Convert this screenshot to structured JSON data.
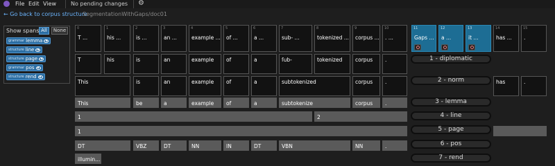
{
  "menubar": {
    "items": [
      "File",
      "Edit",
      "View"
    ],
    "status": "No pending changes"
  },
  "breadcrumb": {
    "back": "Go back to corpus structure",
    "path": "SegmentationWithGaps/doc01"
  },
  "left_panel": {
    "show_spans": "Show spans",
    "all": "All",
    "none": "None",
    "layers": [
      {
        "type": "grammar",
        "name": "lemma"
      },
      {
        "type": "structure",
        "name": "line"
      },
      {
        "type": "structure",
        "name": "page"
      },
      {
        "type": "grammar",
        "name": "pos"
      },
      {
        "type": "structure",
        "name": "rend"
      }
    ]
  },
  "tokens": [
    {
      "idx": "0",
      "text": "T ..."
    },
    {
      "idx": "1",
      "text": "his ..."
    },
    {
      "idx": "2",
      "text": "is ..."
    },
    {
      "idx": "3",
      "text": "an ..."
    },
    {
      "idx": "4",
      "text": "example ..."
    },
    {
      "idx": "5",
      "text": "of ..."
    },
    {
      "idx": "6",
      "text": "a ..."
    },
    {
      "idx": "7",
      "text": "sub- ..."
    },
    {
      "idx": "8",
      "text": "tokenized ..."
    },
    {
      "idx": "9",
      "text": "corpus ..."
    },
    {
      "idx": "10",
      "text": ". ..."
    },
    {
      "idx": "11",
      "text": "Gaps ..."
    },
    {
      "idx": "12",
      "text": "a ..."
    },
    {
      "idx": "13",
      "text": "it ..."
    },
    {
      "idx": "14",
      "text": "has ..."
    },
    {
      "idx": "15",
      "text": "."
    }
  ],
  "rows": {
    "diplomatic": [
      "T",
      "his",
      "is",
      "an",
      "example",
      "of",
      "a",
      "ſub-",
      "tokenized",
      "corpus",
      "."
    ],
    "norm": [
      "This",
      "is",
      "an",
      "example",
      "of",
      "a",
      "subtokenized",
      "corpus",
      ".",
      "has",
      "."
    ],
    "lemma": [
      "This",
      "be",
      "a",
      "example",
      "of",
      "a",
      "subtokenize",
      "corpus",
      "."
    ],
    "line": [
      "1",
      "2"
    ],
    "page": [
      "1"
    ],
    "pos": [
      "DT",
      "VBZ",
      "DT",
      "NN",
      "IN",
      "DT",
      "VBN",
      "NN",
      "."
    ],
    "rend": [
      "illumin..."
    ]
  },
  "layer_labels": [
    "1 - diplomatic",
    "2 - norm",
    "3 - lemma",
    "4 - line",
    "5 - page",
    "6 - pos",
    "7 - rend"
  ],
  "colors": {
    "accent": "#2c6ea3",
    "gap_token": "#1d6d94",
    "annotation": "#5a5a5a"
  }
}
